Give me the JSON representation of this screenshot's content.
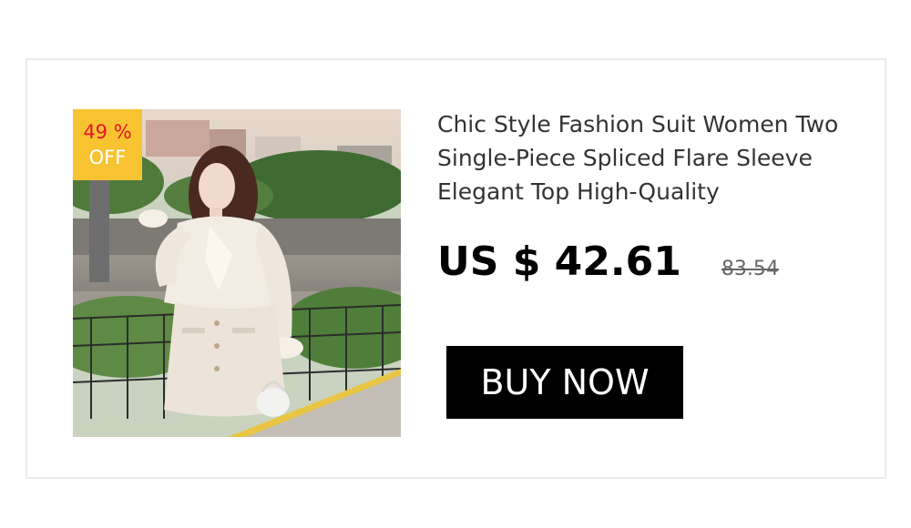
{
  "product": {
    "title": "Chic Style Fashion Suit Women Two Single-Piece Spliced Flare Sleeve Elegant Top High-Quality",
    "image_icon": "product-photo-woman-white-suit",
    "discount": {
      "percent_label": "49 %",
      "off_label": "OFF",
      "badge_color": "#f7c331",
      "percent_color": "#e4162b"
    },
    "price": {
      "current": "US $ 42.61",
      "original": "83.54"
    },
    "buy_button_label": "BUY NOW"
  }
}
